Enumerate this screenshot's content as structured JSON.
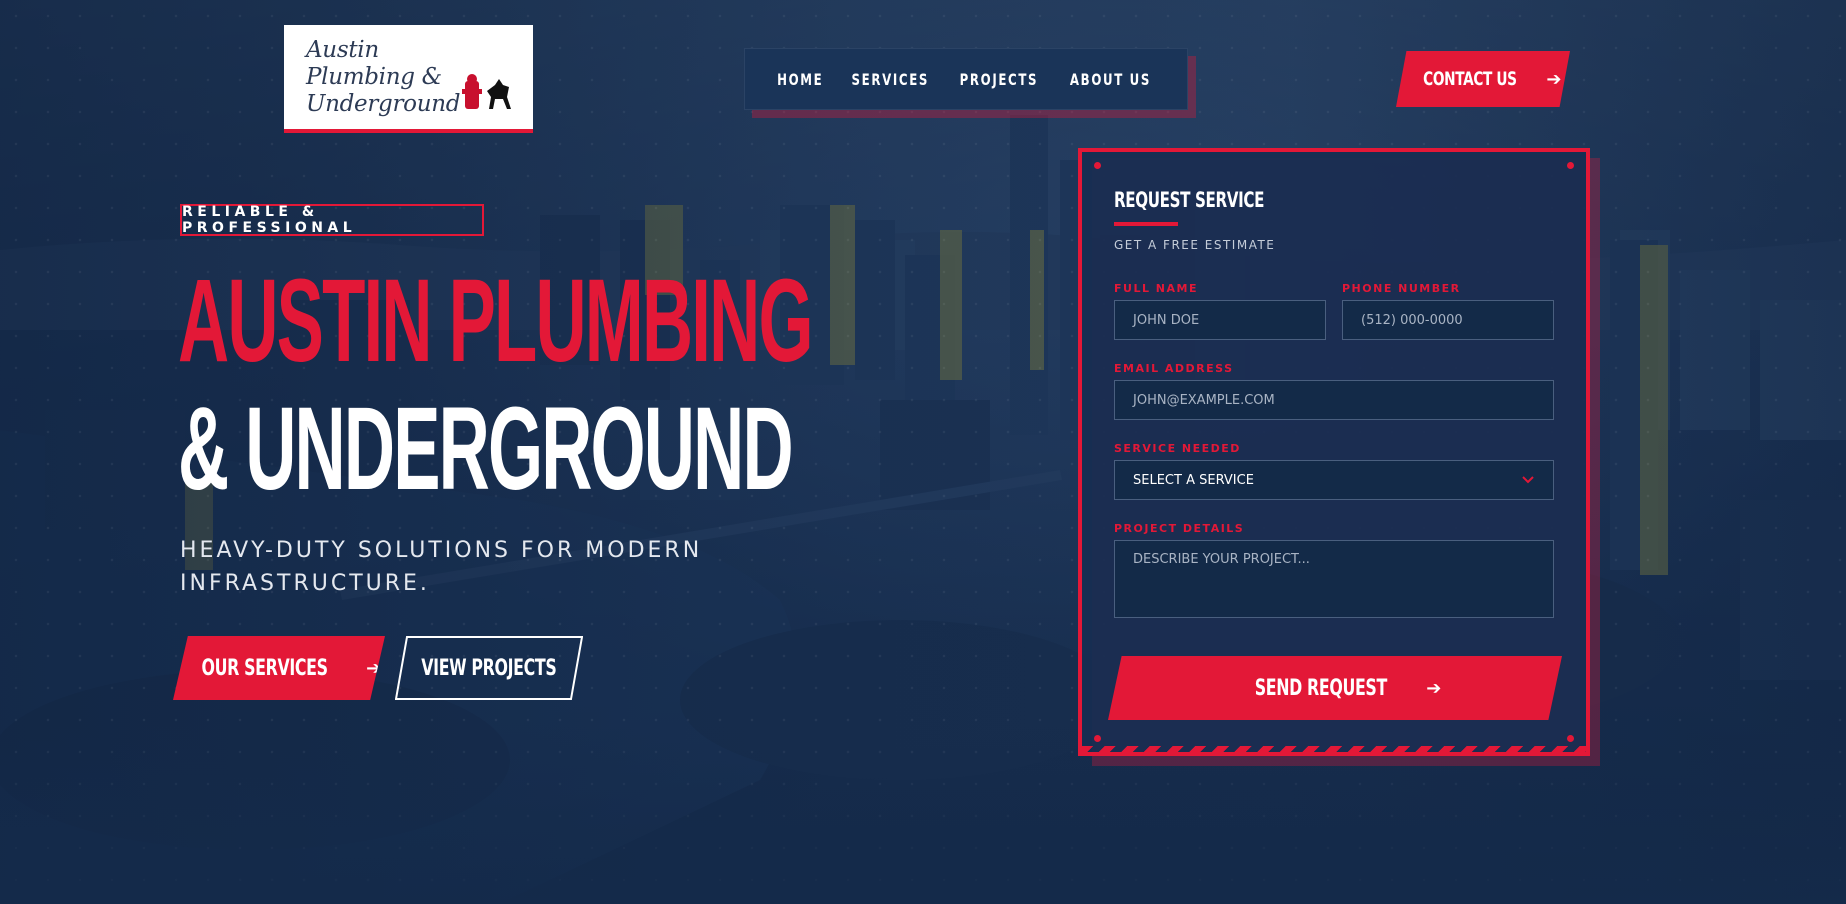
{
  "brand": {
    "logo_lines": [
      "Austin",
      "Plumbing &",
      "Underground"
    ],
    "accent_color": "#e31837",
    "navy_color": "#1a3458"
  },
  "nav": {
    "items": [
      "HOME",
      "SERVICES",
      "PROJECTS",
      "ABOUT US"
    ]
  },
  "header": {
    "contact_label": "CONTACT US",
    "contact_icon": "arrow-right-icon"
  },
  "hero": {
    "badge": "RELIABLE & PROFESSIONAL",
    "title_line1": "AUSTIN PLUMBING",
    "title_line2": "& UNDERGROUND",
    "subtitle": "HEAVY-DUTY SOLUTIONS FOR MODERN INFRASTRUCTURE.",
    "primary_button": "OUR SERVICES",
    "secondary_button": "VIEW PROJECTS"
  },
  "form": {
    "title": "REQUEST SERVICE",
    "subtitle": "GET A FREE ESTIMATE",
    "full_name_label": "FULL NAME",
    "full_name_placeholder": "JOHN DOE",
    "phone_label": "PHONE NUMBER",
    "phone_placeholder": "(512) 000-0000",
    "email_label": "EMAIL ADDRESS",
    "email_placeholder": "JOHN@EXAMPLE.COM",
    "service_label": "SERVICE NEEDED",
    "service_selected": "SELECT A SERVICE",
    "details_label": "PROJECT DETAILS",
    "details_placeholder": "DESCRIBE YOUR PROJECT...",
    "submit_label": "SEND REQUEST"
  }
}
